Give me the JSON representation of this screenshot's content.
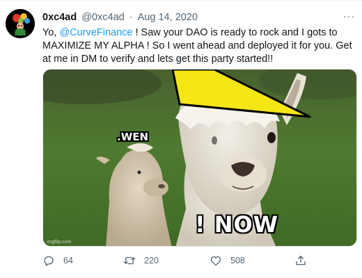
{
  "tweet": {
    "display_name": "0xc4ad",
    "handle": "@0xc4ad",
    "separator": "·",
    "date": "Aug 14, 2020",
    "more_label": "···",
    "text_before": "Yo, ",
    "mention": "@CurveFinance",
    "text_after": " ! Saw your DAO is ready to rock and I gots to MAXIMIZE MY ALPHA ! So I went ahead and deployed it for you. Get at me in DM to verify and lets get this party started!!",
    "media": {
      "caption_top": ".WEN",
      "caption_bottom": "! NOW",
      "watermark": "imgflip.com"
    },
    "actions": {
      "reply_count": "64",
      "retweet_count": "220",
      "like_count": "508"
    }
  },
  "colors": {
    "accent": "#1d9bf0",
    "text": "#0f1419",
    "secondary": "#536471",
    "hat": "#f5e616"
  },
  "icons": {
    "reply": "reply-icon",
    "retweet": "retweet-icon",
    "like": "heart-icon",
    "share": "share-icon",
    "more": "more-icon"
  }
}
